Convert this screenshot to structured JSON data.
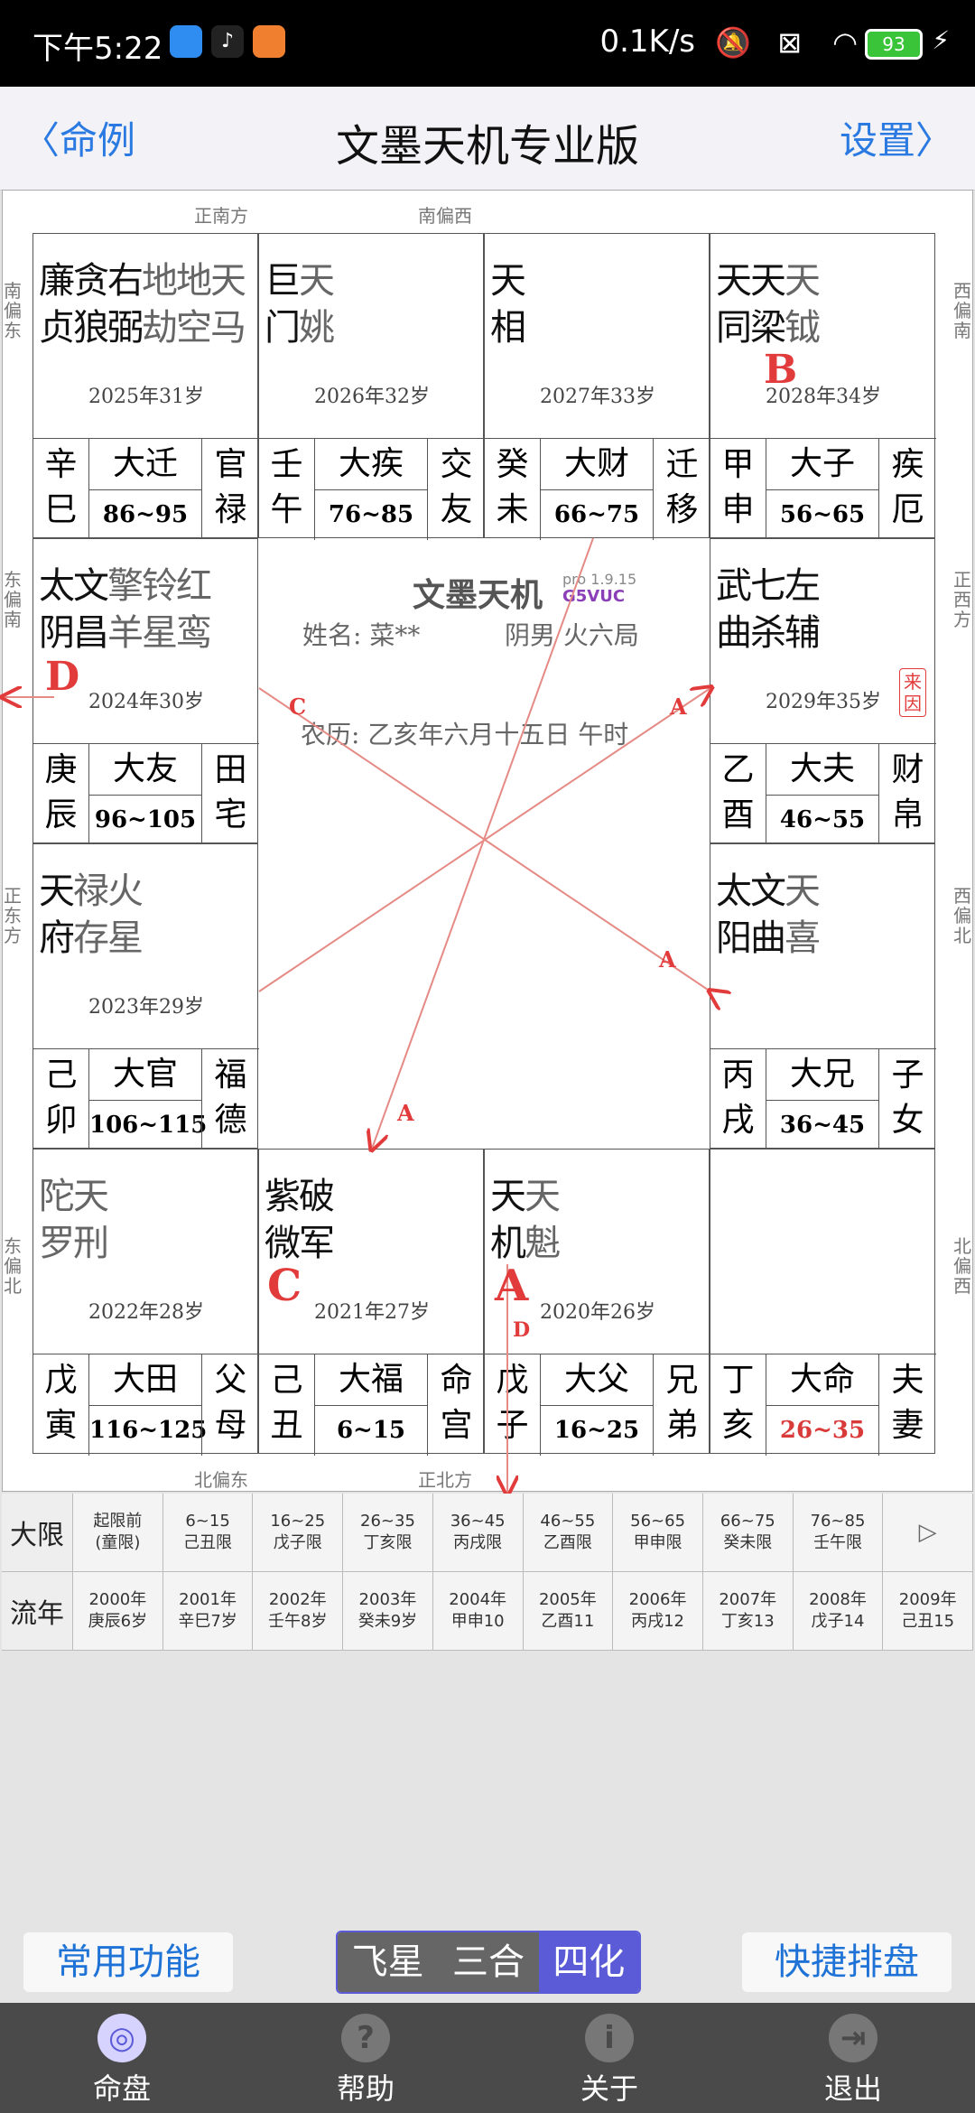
{
  "status": {
    "time": "下午5:22",
    "net": "0.1K/s",
    "battery": "93"
  },
  "nav": {
    "back": "命例",
    "title": "文墨天机专业版",
    "settings": "设置"
  },
  "directions": {
    "top1": "正南方",
    "top2": "南偏西",
    "bottom1": "北偏东",
    "bottom2": "正北方",
    "left1": "南偏东",
    "left2": "东偏南",
    "left3": "正东方",
    "left4": "东偏北",
    "right1": "西偏南",
    "right2": "正西方",
    "right3": "西偏北",
    "right4": "北偏西"
  },
  "palaces": [
    {
      "stars": [
        [
          "廉",
          "m"
        ],
        [
          "贪",
          "m"
        ],
        [
          "右",
          "m"
        ],
        [
          "地",
          "n"
        ],
        [
          "地",
          "n"
        ],
        [
          "天",
          "n"
        ]
      ],
      "stars2": [
        [
          "贞",
          "m"
        ],
        [
          "狼",
          "m"
        ],
        [
          "弼",
          "m"
        ],
        [
          "劫",
          "n"
        ],
        [
          "空",
          "n"
        ],
        [
          "马",
          "n"
        ]
      ],
      "age": "2025年31岁",
      "gz1": "辛",
      "gz2": "巳",
      "dx": "大迁",
      "range": "86~95",
      "pn1": "官",
      "pn2": "禄"
    },
    {
      "stars": [
        [
          "巨",
          "m"
        ],
        [
          "天",
          "n"
        ]
      ],
      "stars2": [
        [
          "门",
          "m"
        ],
        [
          "姚",
          "n"
        ]
      ],
      "age": "2026年32岁",
      "gz1": "壬",
      "gz2": "午",
      "dx": "大疾",
      "range": "76~85",
      "pn1": "交",
      "pn2": "友"
    },
    {
      "stars": [
        [
          "天",
          "m"
        ]
      ],
      "stars2": [
        [
          "相",
          "m"
        ]
      ],
      "age": "2027年33岁",
      "gz1": "癸",
      "gz2": "未",
      "dx": "大财",
      "range": "66~75",
      "pn1": "迁",
      "pn2": "移"
    },
    {
      "stars": [
        [
          "天",
          "m"
        ],
        [
          "天",
          "m"
        ],
        [
          "天",
          "n"
        ]
      ],
      "stars2": [
        [
          "同",
          "m"
        ],
        [
          "梁",
          "m"
        ],
        [
          "钺",
          "n"
        ]
      ],
      "age": "2028年34岁",
      "gz1": "甲",
      "gz2": "申",
      "dx": "大子",
      "range": "56~65",
      "pn1": "疾",
      "pn2": "厄"
    },
    {
      "stars": [
        [
          "太",
          "m"
        ],
        [
          "文",
          "m"
        ],
        [
          "擎",
          "n"
        ],
        [
          "铃",
          "n"
        ],
        [
          "红",
          "n"
        ]
      ],
      "stars2": [
        [
          "阴",
          "m"
        ],
        [
          "昌",
          "m"
        ],
        [
          "羊",
          "n"
        ],
        [
          "星",
          "n"
        ],
        [
          "鸾",
          "n"
        ]
      ],
      "age": "2024年30岁",
      "gz1": "庚",
      "gz2": "辰",
      "dx": "大友",
      "range": "96~105",
      "pn1": "田",
      "pn2": "宅"
    },
    {
      "stars": [
        [
          "武",
          "m"
        ],
        [
          "七",
          "m"
        ],
        [
          "左",
          "m"
        ]
      ],
      "stars2": [
        [
          "曲",
          "m"
        ],
        [
          "杀",
          "m"
        ],
        [
          "辅",
          "m"
        ]
      ],
      "age": "2029年35岁",
      "gz1": "乙",
      "gz2": "酉",
      "dx": "大夫",
      "range": "46~55",
      "pn1": "财",
      "pn2": "帛"
    },
    {
      "stars": [
        [
          "天",
          "m"
        ],
        [
          "禄",
          "n"
        ],
        [
          "火",
          "n"
        ]
      ],
      "stars2": [
        [
          "府",
          "m"
        ],
        [
          "存",
          "n"
        ],
        [
          "星",
          "n"
        ]
      ],
      "age": "2023年29岁",
      "gz1": "己",
      "gz2": "卯",
      "dx": "大官",
      "range": "106~115",
      "pn1": "福",
      "pn2": "德"
    },
    {
      "stars": [
        [
          "太",
          "m"
        ],
        [
          "文",
          "m"
        ],
        [
          "天",
          "n"
        ]
      ],
      "stars2": [
        [
          "阳",
          "m"
        ],
        [
          "曲",
          "m"
        ],
        [
          "喜",
          "n"
        ]
      ],
      "age": "",
      "gz1": "丙",
      "gz2": "戌",
      "dx": "大兄",
      "range": "36~45",
      "pn1": "子",
      "pn2": "女"
    },
    {
      "stars": [
        [
          "陀",
          "n"
        ],
        [
          "天",
          "n"
        ]
      ],
      "stars2": [
        [
          "罗",
          "n"
        ],
        [
          "刑",
          "n"
        ]
      ],
      "age": "2022年28岁",
      "gz1": "戊",
      "gz2": "寅",
      "dx": "大田",
      "range": "116~125",
      "pn1": "父",
      "pn2": "母"
    },
    {
      "stars": [
        [
          "紫",
          "m"
        ],
        [
          "破",
          "m"
        ]
      ],
      "stars2": [
        [
          "微",
          "m"
        ],
        [
          "军",
          "m"
        ]
      ],
      "age": "2021年27岁",
      "gz1": "己",
      "gz2": "丑",
      "dx": "大福",
      "range": "6~15",
      "pn1": "命",
      "pn2": "宫"
    },
    {
      "stars": [
        [
          "天",
          "m"
        ],
        [
          "天",
          "n"
        ]
      ],
      "stars2": [
        [
          "机",
          "m"
        ],
        [
          "魁",
          "n"
        ]
      ],
      "age": "2020年26岁",
      "gz1": "戊",
      "gz2": "子",
      "dx": "大父",
      "range": "16~25",
      "pn1": "兄",
      "pn2": "弟"
    },
    {
      "stars": [],
      "stars2": [],
      "age": "",
      "gz1": "丁",
      "gz2": "亥",
      "dx": "大命",
      "range": "26~35",
      "pn1": "夫",
      "pn2": "妻"
    }
  ],
  "center": {
    "title": "文墨天机",
    "version": "pro 1.9.15",
    "code": "G5VUC",
    "name": "姓名: 菜**",
    "gender": "阴男 火六局",
    "lunar": "农历: 乙亥年六月十五日 午时"
  },
  "marks": {
    "b": "B",
    "d": "D",
    "c": "C",
    "a": "A",
    "arrowA": "A",
    "arrowC": "C",
    "arrowD": "D",
    "laiyin": "来因"
  },
  "daxian": {
    "label": "大限",
    "cells": [
      [
        "起限前",
        "(童限)"
      ],
      [
        "6~15",
        "己丑限"
      ],
      [
        "16~25",
        "戊子限"
      ],
      [
        "26~35",
        "丁亥限"
      ],
      [
        "36~45",
        "丙戌限"
      ],
      [
        "46~55",
        "乙酉限"
      ],
      [
        "56~65",
        "甲申限"
      ],
      [
        "66~75",
        "癸未限"
      ],
      [
        "76~85",
        "壬午限"
      ],
      [
        "▷",
        ""
      ]
    ]
  },
  "liunian": {
    "label": "流年",
    "cells": [
      [
        "2000年",
        "庚辰6岁"
      ],
      [
        "2001年",
        "辛巳7岁"
      ],
      [
        "2002年",
        "壬午8岁"
      ],
      [
        "2003年",
        "癸未9岁"
      ],
      [
        "2004年",
        "甲申10"
      ],
      [
        "2005年",
        "乙酉11"
      ],
      [
        "2006年",
        "丙戌12"
      ],
      [
        "2007年",
        "丁亥13"
      ],
      [
        "2008年",
        "戊子14"
      ],
      [
        "2009年",
        "己丑15"
      ]
    ]
  },
  "actions": {
    "common": "常用功能",
    "quick": "快捷排盘",
    "seg": [
      "飞星",
      "三合",
      "四化"
    ]
  },
  "tabs": [
    {
      "label": "命盘",
      "icon": "◎"
    },
    {
      "label": "帮助",
      "icon": "?"
    },
    {
      "label": "关于",
      "icon": "i"
    },
    {
      "label": "退出",
      "icon": "⇥"
    }
  ],
  "colors": {
    "accent": "#2a7ae2",
    "mark": "#e23b3b",
    "segActive": "#5b5bd8"
  }
}
